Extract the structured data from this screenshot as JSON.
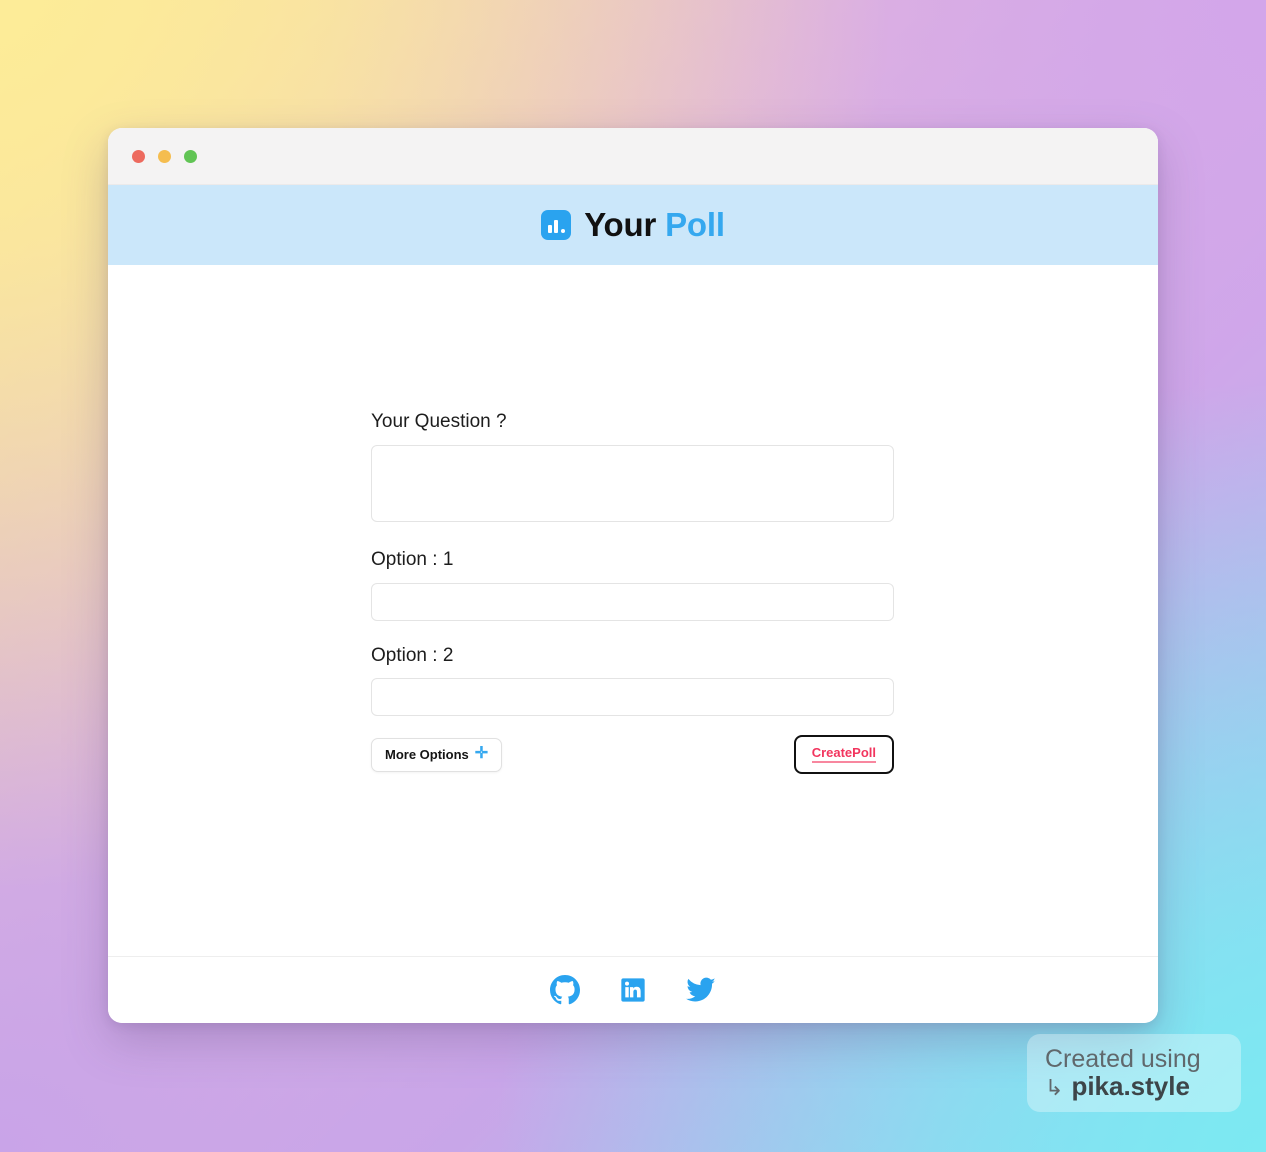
{
  "window": {
    "traffic_lights": [
      {
        "name": "close",
        "color": "#ed6a5e"
      },
      {
        "name": "minimize",
        "color": "#f5bd4f"
      },
      {
        "name": "maximize",
        "color": "#61c454"
      }
    ]
  },
  "header": {
    "logo_icon": "bar-chart-icon",
    "title_primary": "Your",
    "title_accent": "Poll",
    "background": "#cbe7fa",
    "accent_color": "#35a8ef"
  },
  "form": {
    "question": {
      "label": "Your Question ?",
      "value": "",
      "placeholder": ""
    },
    "options": [
      {
        "label": "Option : 1",
        "value": "",
        "placeholder": ""
      },
      {
        "label": "Option : 2",
        "value": "",
        "placeholder": ""
      }
    ],
    "more_options_button": {
      "label": "More Options",
      "icon": "plus-icon",
      "icon_glyph": "✛",
      "icon_color": "#35a8ef"
    },
    "create_poll_button": {
      "label": "CreatePoll",
      "text_color": "#f2355e",
      "border_color": "#111111"
    }
  },
  "footer": {
    "social_links": [
      {
        "name": "github",
        "label": "GitHub"
      },
      {
        "name": "linkedin",
        "label": "LinkedIn"
      },
      {
        "name": "twitter",
        "label": "Twitter"
      }
    ],
    "icon_color": "#2aa3ef"
  },
  "watermark": {
    "line1": "Created using",
    "arrow": "↳",
    "line2": "pika.style"
  }
}
